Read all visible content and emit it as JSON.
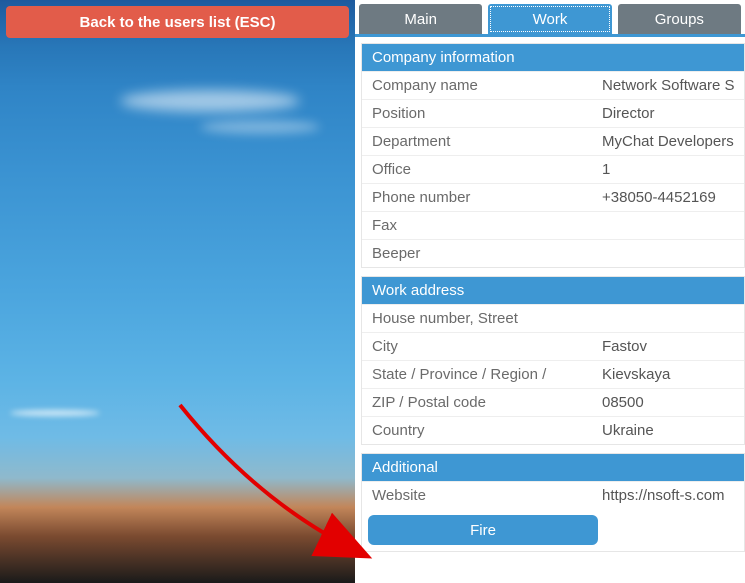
{
  "back_button_label": "Back to the users list (ESC)",
  "tabs": {
    "main": "Main",
    "work": "Work",
    "groups": "Groups"
  },
  "sections": {
    "company_info": {
      "title": "Company information",
      "rows": [
        {
          "k": "Company name",
          "v": "Network Software S"
        },
        {
          "k": "Position",
          "v": "Director"
        },
        {
          "k": "Department",
          "v": "MyChat Developers"
        },
        {
          "k": "Office",
          "v": "1"
        },
        {
          "k": "Phone number",
          "v": "+38050-4452169"
        },
        {
          "k": "Fax",
          "v": ""
        },
        {
          "k": "Beeper",
          "v": ""
        }
      ]
    },
    "work_address": {
      "title": "Work address",
      "rows": [
        {
          "k": "House number, Street",
          "v": ""
        },
        {
          "k": "City",
          "v": "Fastov"
        },
        {
          "k": "State / Province / Region /",
          "v": "Kievskaya"
        },
        {
          "k": "ZIP / Postal code",
          "v": "08500"
        },
        {
          "k": "Country",
          "v": "Ukraine"
        }
      ]
    },
    "additional": {
      "title": "Additional",
      "rows": [
        {
          "k": "Website",
          "v": "https://nsoft-s.com"
        }
      ]
    }
  },
  "fire_button_label": "Fire"
}
